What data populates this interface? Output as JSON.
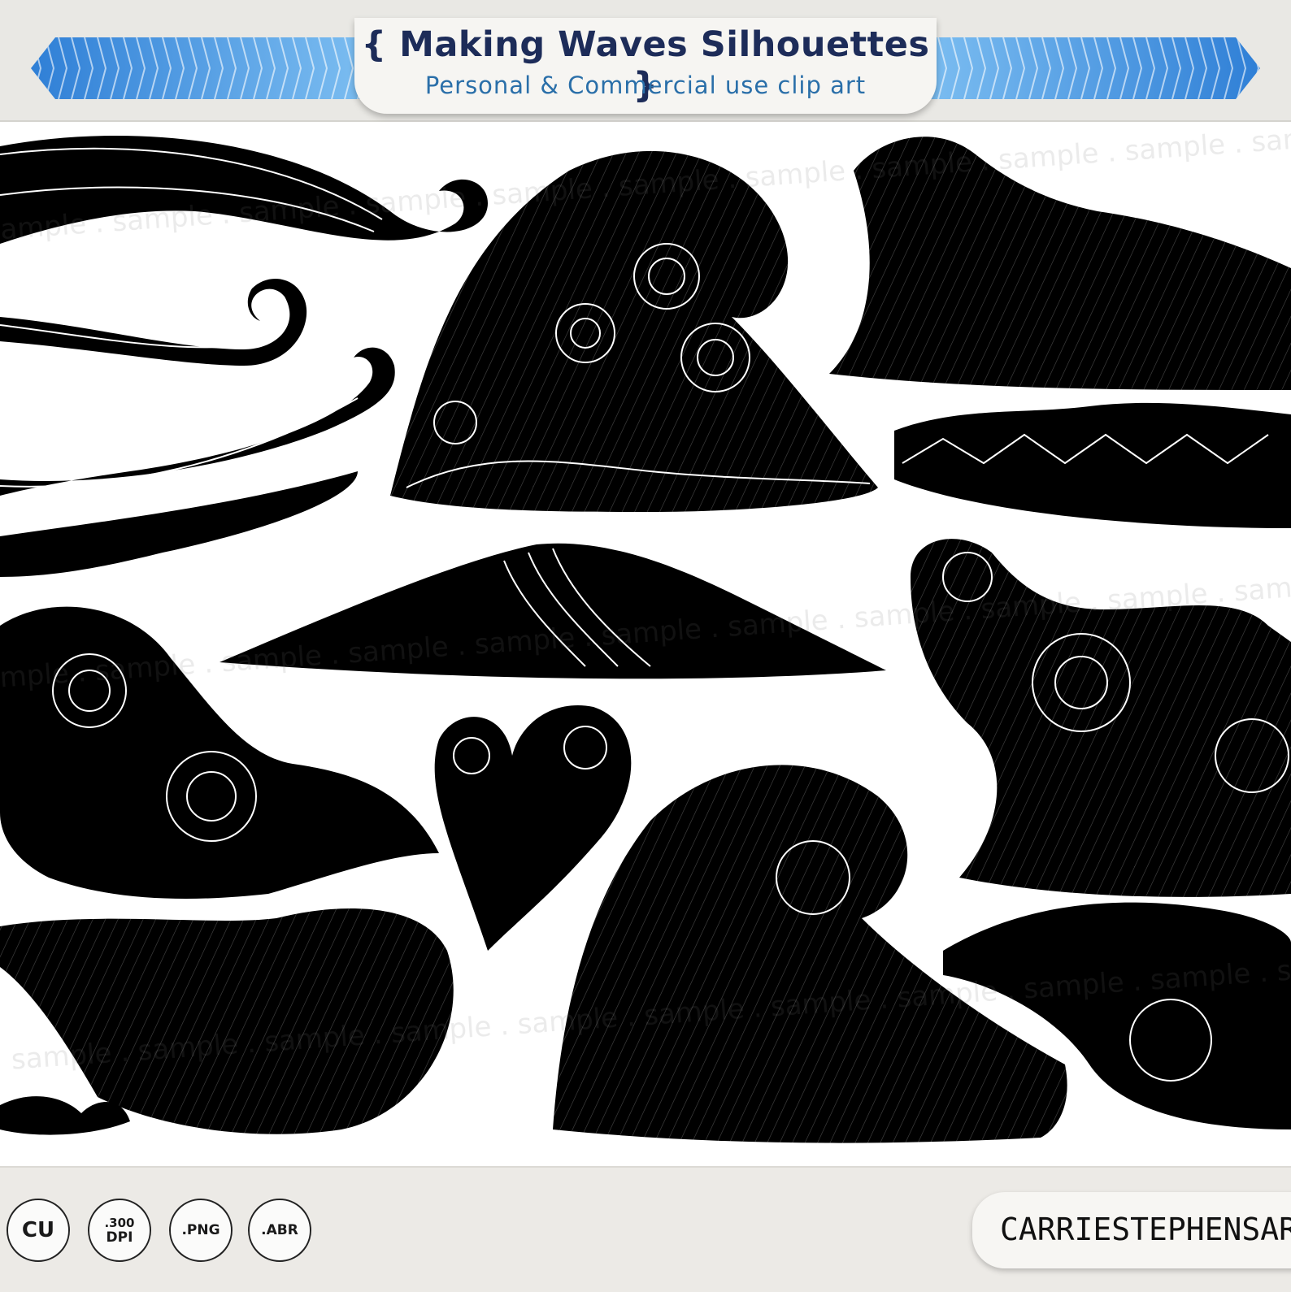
{
  "header": {
    "title": "{ Making Waves Silhouettes }",
    "subtitle": "Personal & Commercial use clip art",
    "ribbon_color": "#3a8ed8"
  },
  "artwork": {
    "watermark_word": "sample",
    "silhouette_color": "#000000",
    "line_color": "#ffffff"
  },
  "footer": {
    "badges": [
      {
        "main": "CU",
        "small": ""
      },
      {
        "main": ".300",
        "small": "DPI"
      },
      {
        "main": ".PNG",
        "small": ""
      },
      {
        "main": ".ABR",
        "small": ""
      }
    ],
    "brand": "CARRIESTEPHENSART"
  }
}
